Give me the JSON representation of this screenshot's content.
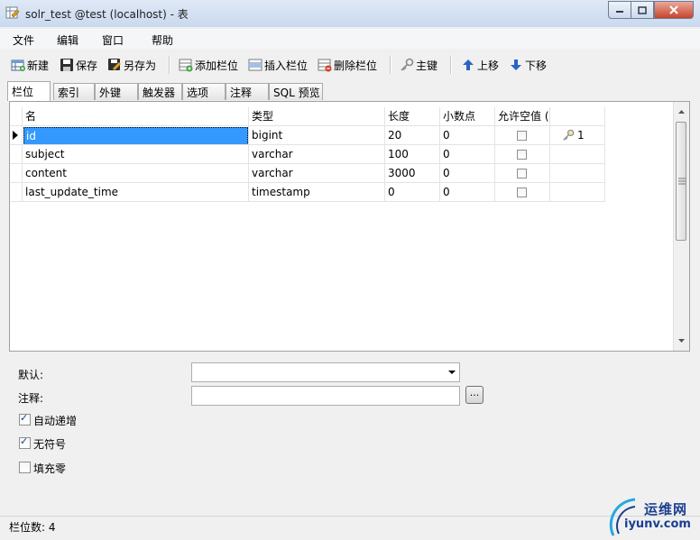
{
  "window": {
    "title": "solr_test @test (localhost) - 表"
  },
  "menu": {
    "items": [
      "文件",
      "编辑",
      "窗口",
      "帮助"
    ]
  },
  "toolbar": {
    "new_label": "新建",
    "save_label": "保存",
    "save_as_label": "另存为",
    "add_field_label": "添加栏位",
    "insert_field_label": "插入栏位",
    "delete_field_label": "删除栏位",
    "primary_key_label": "主键",
    "move_up_label": "上移",
    "move_down_label": "下移"
  },
  "tabs": [
    "栏位",
    "索引",
    "外键",
    "触发器",
    "选项",
    "注释",
    "SQL 预览"
  ],
  "grid": {
    "headers": [
      "名",
      "类型",
      "长度",
      "小数点",
      "允许空值 ("
    ],
    "rows": [
      {
        "name": "id",
        "type": "bigint",
        "length": "20",
        "decimals": "0",
        "allow_null": false,
        "key": "1"
      },
      {
        "name": "subject",
        "type": "varchar",
        "length": "100",
        "decimals": "0",
        "allow_null": false,
        "key": ""
      },
      {
        "name": "content",
        "type": "varchar",
        "length": "3000",
        "decimals": "0",
        "allow_null": false,
        "key": ""
      },
      {
        "name": "last_update_time",
        "type": "timestamp",
        "length": "0",
        "decimals": "0",
        "allow_null": false,
        "key": ""
      }
    ]
  },
  "properties": {
    "default_label": "默认:",
    "comment_label": "注释:",
    "ellipsis_label": "...",
    "auto_increment_label": "自动递增",
    "auto_increment_checked": true,
    "unsigned_label": "无符号",
    "unsigned_checked": true,
    "zerofill_label": "填充零",
    "zerofill_checked": false
  },
  "status": {
    "text": "栏位数: 4"
  },
  "watermark": {
    "cn": "运维网",
    "en": "iyunv.com"
  },
  "colors": {
    "selection": "#3399ff",
    "titlebar": "#c9d9ee",
    "close_button": "#c7432a"
  }
}
